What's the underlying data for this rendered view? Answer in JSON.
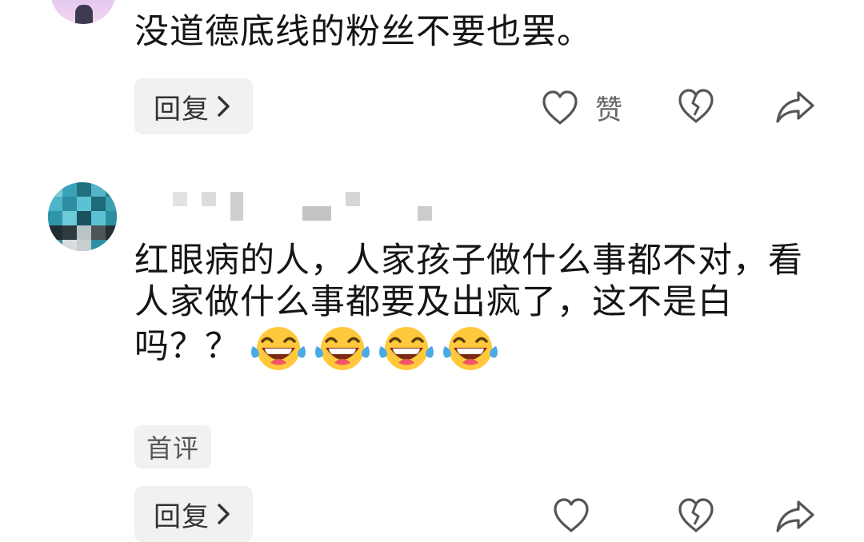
{
  "comment_1": {
    "text": "没道德底线的粉丝不要也罢。",
    "reply_label": "回复",
    "like_label": "赞"
  },
  "comment_2": {
    "text_line_1": "红眼病的人，人家孩子做什么事都不对，看",
    "text_line_2": "人家做什么事都要及出疯了，这不是白",
    "text_line_3": "吗？？",
    "emoji_count": 4,
    "emoji_name": "tears-of-joy-emoji",
    "badge": "首评",
    "reply_label": "回复"
  },
  "icons": {
    "like": "heart-outline-icon",
    "dislike": "broken-heart-icon",
    "share": "share-arrow-icon",
    "chevron": "chevron-right-icon"
  },
  "colors": {
    "icon": "#555555",
    "pill_bg": "#f1f1f1",
    "text": "#151515"
  }
}
